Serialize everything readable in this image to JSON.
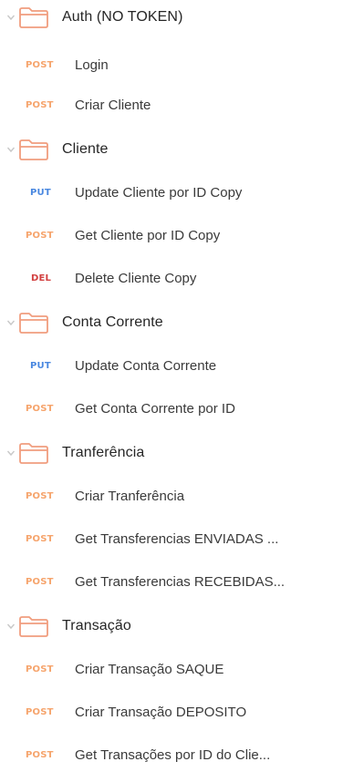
{
  "colors": {
    "folder_stroke": "#f19d7e",
    "chevron": "#c8c8c8",
    "post": "#f6a46c",
    "put": "#4a88e0",
    "del": "#d24040"
  },
  "tree": [
    {
      "folder": "Auth (NO TOKEN)",
      "requests": [
        {
          "method": "POST",
          "label": "Login"
        },
        {
          "method": "POST",
          "label": "Criar Cliente"
        }
      ]
    },
    {
      "folder": "Cliente",
      "requests": [
        {
          "method": "PUT",
          "label": "Update Cliente por ID Copy"
        },
        {
          "method": "POST",
          "label": "Get Cliente por ID Copy"
        },
        {
          "method": "DEL",
          "label": "Delete Cliente Copy"
        }
      ]
    },
    {
      "folder": "Conta Corrente",
      "requests": [
        {
          "method": "PUT",
          "label": "Update Conta Corrente"
        },
        {
          "method": "POST",
          "label": "Get Conta Corrente por ID"
        }
      ]
    },
    {
      "folder": "Tranferência",
      "requests": [
        {
          "method": "POST",
          "label": "Criar Tranferência"
        },
        {
          "method": "POST",
          "label": "Get Transferencias ENVIADAS ..."
        },
        {
          "method": "POST",
          "label": "Get Transferencias RECEBIDAS..."
        }
      ]
    },
    {
      "folder": "Transação",
      "requests": [
        {
          "method": "POST",
          "label": "Criar Transação SAQUE"
        },
        {
          "method": "POST",
          "label": "Criar Transação DEPOSITO"
        },
        {
          "method": "POST",
          "label": "Get Transações por ID do Clie..."
        }
      ]
    }
  ]
}
